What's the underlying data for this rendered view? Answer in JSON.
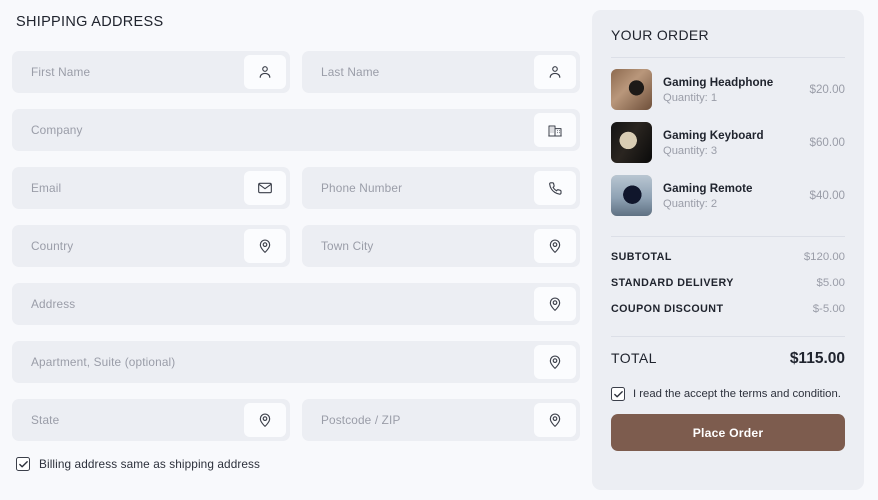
{
  "shipping": {
    "title": "SHIPPING ADDRESS",
    "rows": [
      [
        {
          "placeholder": "First Name",
          "icon": "user-icon"
        },
        {
          "placeholder": "Last Name",
          "icon": "user-icon"
        }
      ],
      [
        {
          "placeholder": "Company",
          "icon": "building-icon"
        }
      ],
      [
        {
          "placeholder": "Email",
          "icon": "mail-icon"
        },
        {
          "placeholder": "Phone Number",
          "icon": "phone-icon"
        }
      ],
      [
        {
          "placeholder": "Country",
          "icon": "location-pin-icon"
        },
        {
          "placeholder": "Town City",
          "icon": "location-pin-icon"
        }
      ],
      [
        {
          "placeholder": "Address",
          "icon": "location-pin-icon"
        }
      ],
      [
        {
          "placeholder": "Apartment, Suite (optional)",
          "icon": "location-pin-icon"
        }
      ],
      [
        {
          "placeholder": "State",
          "icon": "location-pin-icon"
        },
        {
          "placeholder": "Postcode / ZIP",
          "icon": "location-pin-icon"
        }
      ]
    ],
    "billing_checkbox": {
      "label": "Billing address same as shipping address",
      "checked": true
    }
  },
  "order": {
    "title": "YOUR ORDER",
    "items": [
      {
        "name": "Gaming Headphone",
        "quantity_label": "Quantity: 1",
        "price": "$20.00"
      },
      {
        "name": "Gaming Keyboard",
        "quantity_label": "Quantity: 3",
        "price": "$60.00"
      },
      {
        "name": "Gaming Remote",
        "quantity_label": "Quantity: 2",
        "price": "$40.00"
      }
    ],
    "totals": [
      {
        "label": "SUBTOTAL",
        "value": "$120.00"
      },
      {
        "label": "STANDARD DELIVERY",
        "value": "$5.00"
      },
      {
        "label": "COUPON DISCOUNT",
        "value": "$-5.00"
      }
    ],
    "grand_total": {
      "label": "TOTAL",
      "value": "$115.00"
    },
    "terms_checkbox": {
      "label": "I read the accept the terms and condition.",
      "checked": true
    },
    "place_order_label": "Place Order"
  },
  "colors": {
    "page_background": "#f8f9fc",
    "field_background": "#eceef3",
    "panel_background": "#eceef3",
    "accent_button": "#7d5c4e",
    "placeholder_text": "#9a9da8",
    "primary_text": "#20242e"
  }
}
